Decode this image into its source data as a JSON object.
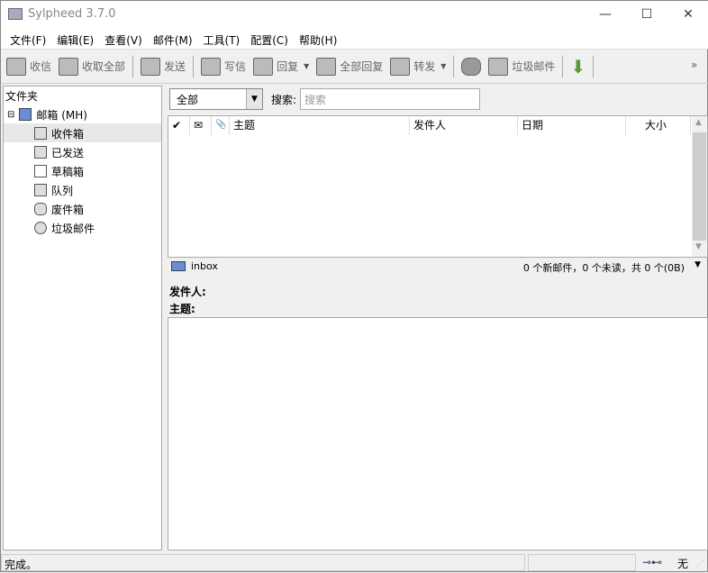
{
  "window": {
    "title": "Sylpheed 3.7.0"
  },
  "menu": [
    "文件(F)",
    "编辑(E)",
    "查看(V)",
    "邮件(M)",
    "工具(T)",
    "配置(C)",
    "帮助(H)"
  ],
  "toolbar": {
    "receive": "收信",
    "receive_all": "收取全部",
    "send": "发送",
    "compose": "写信",
    "reply": "回复",
    "reply_all": "全部回复",
    "forward": "转发",
    "junk": "垃圾邮件",
    "more": "»"
  },
  "folders": {
    "title": "文件夹",
    "mailbox": "邮箱 (MH)",
    "items": [
      "收件箱",
      "已发送",
      "草稿箱",
      "队列",
      "废件箱",
      "垃圾邮件"
    ]
  },
  "filter": {
    "value": "全部",
    "search_label": "搜索:",
    "search_placeholder": "搜索"
  },
  "columns": {
    "mark": "✔",
    "unread": "✉",
    "attach": "📎",
    "subject": "主题",
    "from": "发件人",
    "date": "日期",
    "size": "大小"
  },
  "folderbar": {
    "name": "inbox",
    "summary": "0 个新邮件，0 个未读，共 0 个(0B)"
  },
  "message": {
    "from_label": "发件人:",
    "subject_label": "主题:"
  },
  "status": {
    "text": "完成。",
    "online": "无"
  }
}
